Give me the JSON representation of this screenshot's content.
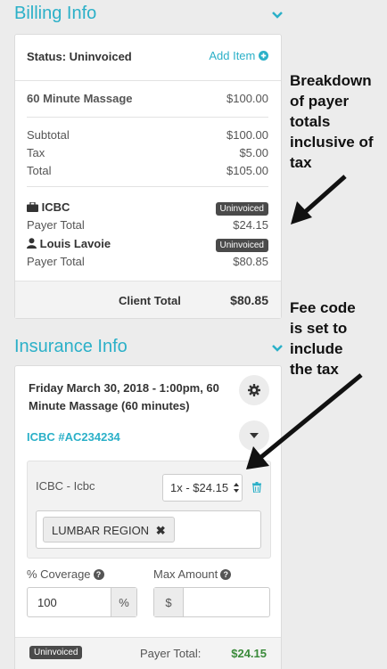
{
  "billing": {
    "title": "Billing Info",
    "status_label": "Status: Uninvoiced",
    "add_item": "Add Item",
    "item": {
      "name": "60 Minute Massage",
      "amount": "$100.00"
    },
    "subtotal_label": "Subtotal",
    "subtotal": "$100.00",
    "tax_label": "Tax",
    "tax": "$5.00",
    "total_label": "Total",
    "total": "$105.00",
    "payers": [
      {
        "name": "ICBC",
        "badge": "Uninvoiced",
        "total_label": "Payer Total",
        "total": "$24.15"
      },
      {
        "name": "Louis Lavoie",
        "badge": "Uninvoiced",
        "total_label": "Payer Total",
        "total": "$80.85"
      }
    ],
    "client_total_label": "Client Total",
    "client_total": "$80.85"
  },
  "insurance": {
    "title": "Insurance Info",
    "appointment_line1": "Friday March 30, 2018 - 1:00pm, 60",
    "appointment_line2": "Minute Massage (60 minutes)",
    "claim": "ICBC #AC234234",
    "fee_label": "ICBC - Icbc",
    "fee_select": "1x - $24.15",
    "region_tag": "LUMBAR REGION",
    "coverage_label": "% Coverage",
    "coverage_value": "100",
    "coverage_unit": "%",
    "max_label": "Max Amount",
    "max_prefix": "$",
    "max_value": "",
    "status_badge": "Uninvoiced",
    "payer_total_label": "Payer Total:",
    "payer_total": "$24.15"
  },
  "annotations": {
    "top": [
      "Breakdown",
      "of payer",
      "totals",
      "inclusive of",
      "tax"
    ],
    "bottom": [
      "Fee code",
      "is set to",
      "include",
      "the tax"
    ]
  },
  "colors": {
    "accent": "#2bb0c8",
    "green_total": "#3a8a3a",
    "badge_bg": "#4a4a4a"
  }
}
